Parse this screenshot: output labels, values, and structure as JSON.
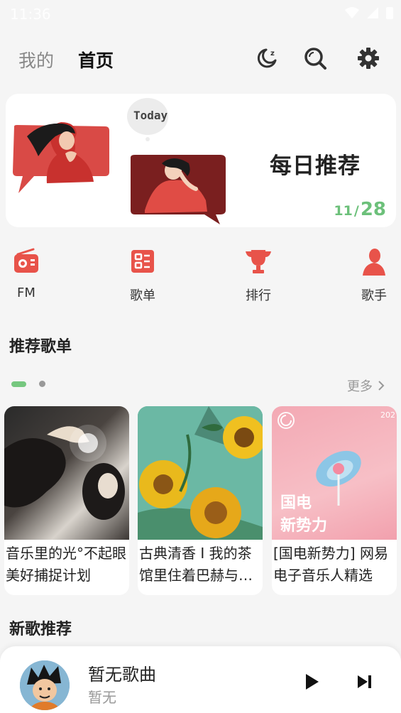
{
  "status": {
    "time": "11:36"
  },
  "topbar": {
    "tab_mine": "我的",
    "tab_home": "首页"
  },
  "banner": {
    "today_badge": "Today",
    "title": "每日推荐",
    "day": "11",
    "total": "28"
  },
  "quick_links": [
    {
      "label": "FM",
      "icon": "radio-icon"
    },
    {
      "label": "歌单",
      "icon": "playlist-icon"
    },
    {
      "label": "排行",
      "icon": "trophy-icon"
    },
    {
      "label": "歌手",
      "icon": "singer-icon"
    }
  ],
  "playlists": {
    "title": "推荐歌单",
    "more": "更多",
    "items": [
      {
        "title": "音乐里的光°不起眼美好捕捉计划"
      },
      {
        "title": "古典清香 I 我的茶馆里住着巴赫与…"
      },
      {
        "title": "[国电新势力] 网易电子音乐人精选",
        "cover_text_1": "国电",
        "cover_text_2": "新势力",
        "cover_year": "202"
      }
    ]
  },
  "new_songs": {
    "title": "新歌推荐"
  },
  "player": {
    "song": "暂无歌曲",
    "artist": "暂无"
  },
  "colors": {
    "accent": "#e8534a",
    "green": "#6cc07a"
  }
}
